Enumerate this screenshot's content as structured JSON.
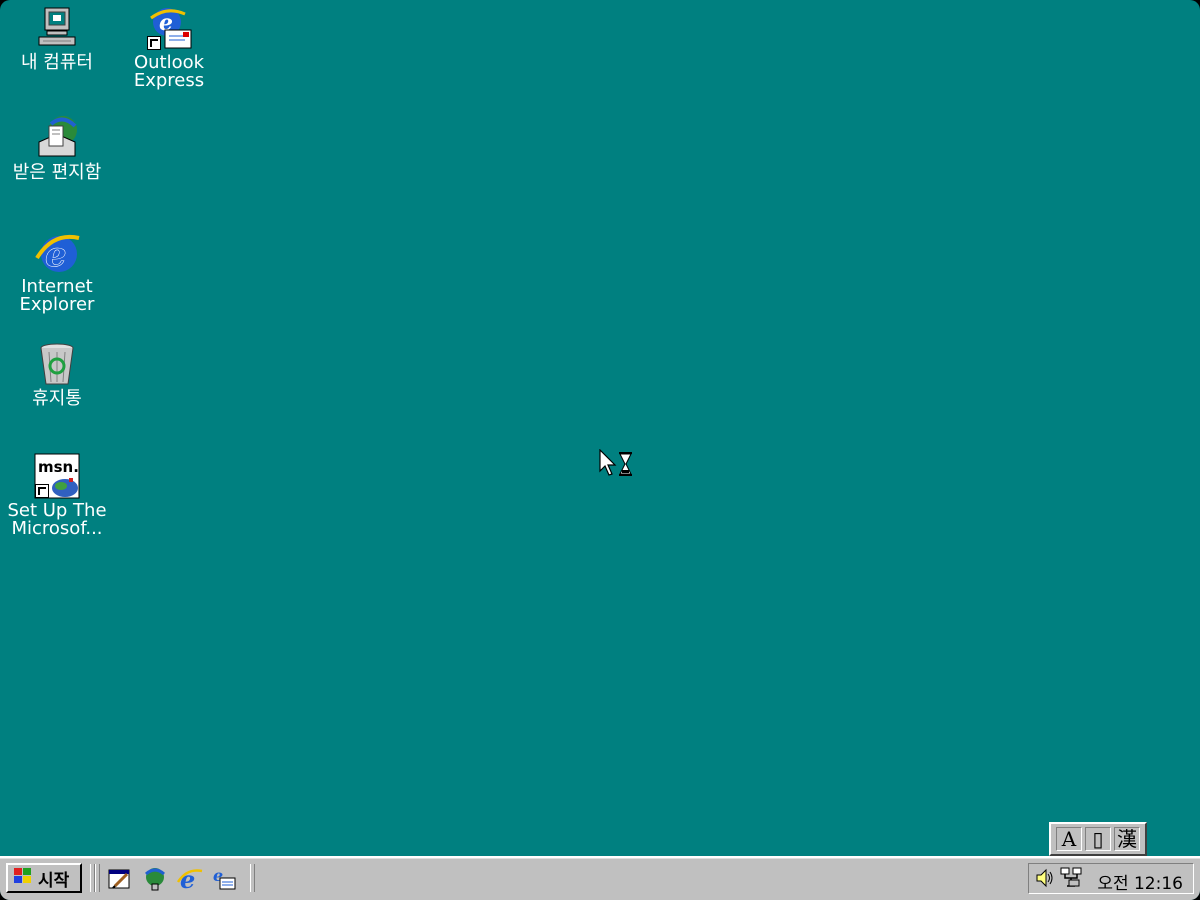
{
  "desktop": {
    "background_color": "#008080",
    "icons": [
      {
        "id": "my-computer",
        "label": "내 컴퓨터",
        "icon": "computer-icon"
      },
      {
        "id": "outlook-express",
        "label": "Outlook\nExpress",
        "icon": "outlook-express-icon"
      },
      {
        "id": "inbox",
        "label": "받은 편지함",
        "icon": "inbox-icon"
      },
      {
        "id": "internet-explorer",
        "label": "Internet\nExplorer",
        "icon": "internet-explorer-icon"
      },
      {
        "id": "recycle-bin",
        "label": "휴지통",
        "icon": "recycle-bin-icon"
      },
      {
        "id": "msn-setup",
        "label": "Set Up The\nMicrosof...",
        "icon": "msn-icon"
      }
    ]
  },
  "ime": {
    "buttons": [
      "A",
      "▯",
      "漢"
    ]
  },
  "taskbar": {
    "start_label": "시작",
    "quick_launch": [
      "show-desktop-icon",
      "channels-icon",
      "internet-explorer-icon",
      "outlook-express-icon"
    ],
    "tray_icons": [
      "volume-icon",
      "network-icon"
    ],
    "clock": "오전 12:16"
  },
  "cursor": "busy-pointer-icon"
}
